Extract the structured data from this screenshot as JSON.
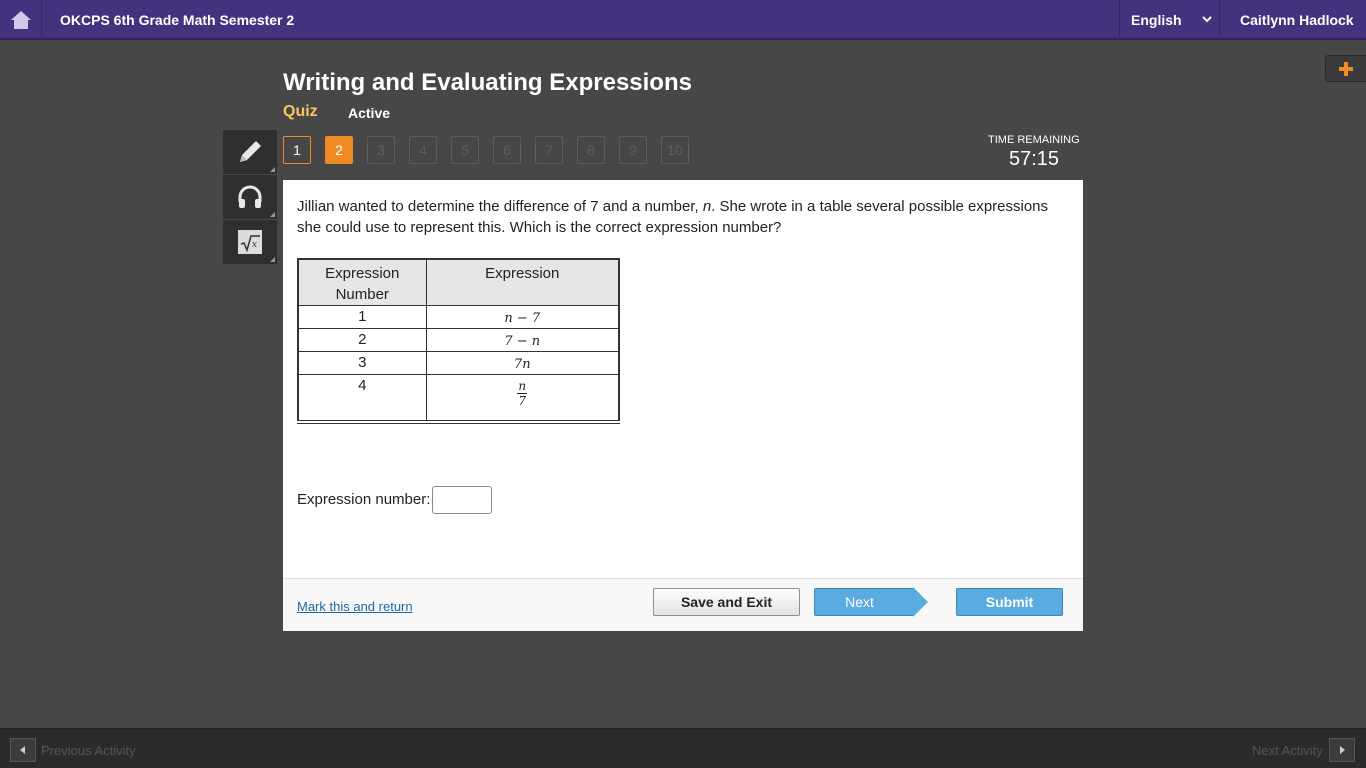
{
  "header": {
    "course_title": "OKCPS 6th Grade Math Semester 2",
    "language": "English",
    "user_name": "Caitlynn Hadlock"
  },
  "activity": {
    "title": "Writing and Evaluating Expressions",
    "type": "Quiz",
    "status": "Active"
  },
  "question_nav": {
    "items": [
      "1",
      "2",
      "3",
      "4",
      "5",
      "6",
      "7",
      "8",
      "9",
      "10"
    ],
    "current": 2,
    "answered": [
      1
    ]
  },
  "timer": {
    "label": "TIME REMAINING",
    "value": "57:15"
  },
  "question": {
    "text_part1": "Jillian wanted to determine the difference of 7 and a number, ",
    "variable": "n",
    "text_part2": ". She wrote in a table several possible expressions she could use to represent this. Which is the correct expression number?",
    "table": {
      "headers": [
        "Expression Number",
        "Expression"
      ],
      "rows": [
        {
          "number": "1",
          "expression": "n − 7"
        },
        {
          "number": "2",
          "expression": "7 − n"
        },
        {
          "number": "3",
          "expression": "7n"
        },
        {
          "number": "4",
          "numerator": "n",
          "denominator": "7"
        }
      ]
    },
    "answer_label": "Expression number:",
    "answer_value": ""
  },
  "footer": {
    "mark_link": "Mark this and return",
    "save_exit": "Save and Exit",
    "next": "Next",
    "submit": "Submit"
  },
  "bottom_nav": {
    "previous": "Previous Activity",
    "next": "Next Activity"
  },
  "colors": {
    "header_bg": "#44327e",
    "accent_orange": "#f08a24",
    "quiz_label": "#f7c660",
    "button_blue": "#5aabdf",
    "link_blue": "#1a6aa5"
  },
  "icons": [
    "home-icon",
    "chevron-down-icon",
    "plus-icon",
    "pencil-icon",
    "headphones-icon",
    "square-root-icon",
    "arrow-left-icon",
    "arrow-right-icon"
  ]
}
